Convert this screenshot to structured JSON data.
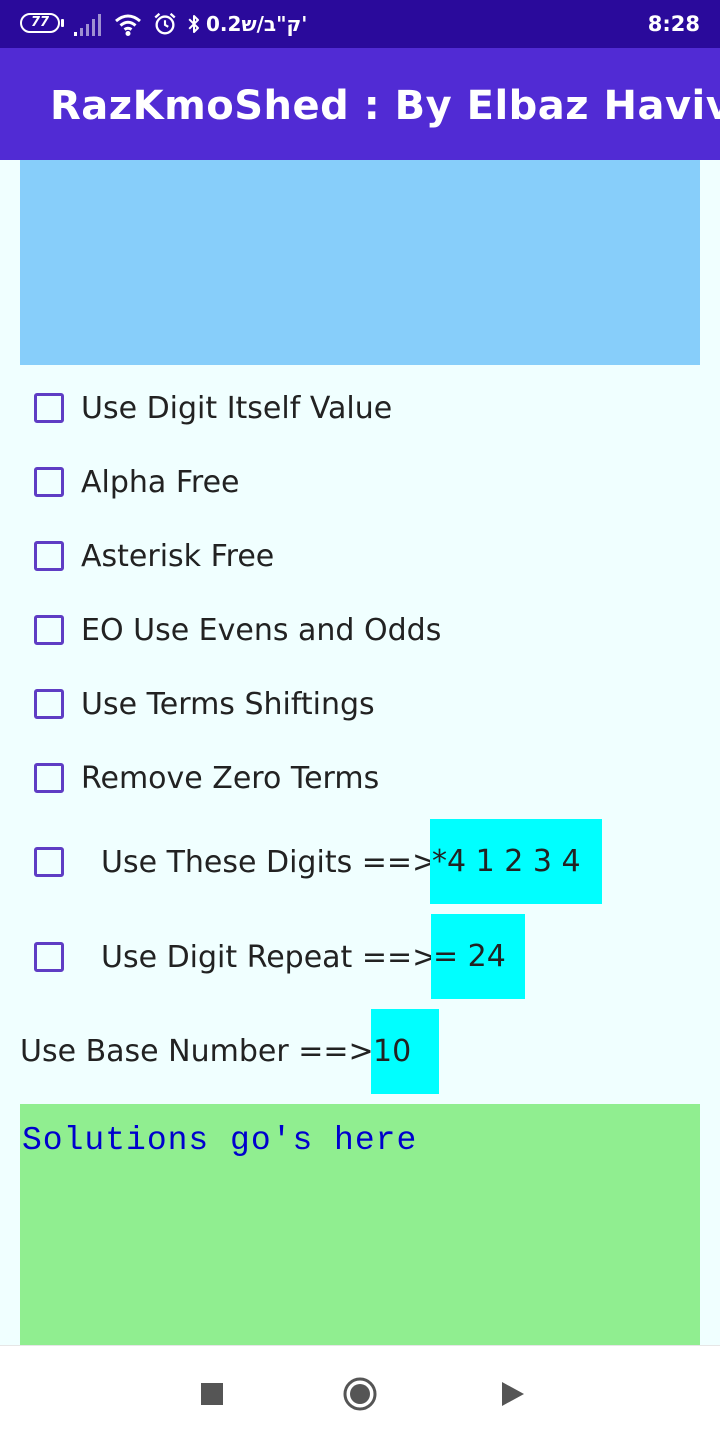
{
  "status_bar": {
    "battery": "77",
    "carrier_text": "0.2ק\"ב/ש'",
    "time": "8:28",
    "icons": [
      "signal-icon",
      "wifi-icon",
      "alarm-icon",
      "bluetooth-icon"
    ]
  },
  "app_bar": {
    "title": "RazKmoShed : By Elbaz Haviv"
  },
  "options": {
    "use_digit_itself_value": "Use Digit Itself Value",
    "alpha_free": "Alpha Free",
    "asterisk_free": "Asterisk Free",
    "eo_use_evens_and_odds": "EO Use Evens and Odds",
    "use_terms_shiftings": "Use Terms Shiftings",
    "remove_zero_terms": "Remove Zero Terms"
  },
  "digits": {
    "label": "Use These Digits ==>",
    "value": "*4 1 2 3 4"
  },
  "repeat": {
    "label": "Use Digit Repeat ==>",
    "value": "= 24"
  },
  "base": {
    "label": "Use Base Number ==>",
    "value": "10"
  },
  "solutions": {
    "text": "Solutions go's here"
  },
  "colors": {
    "status_bar": "#2a0a9b",
    "app_bar": "#512bd4",
    "top_panel": "#87cefa",
    "page_background": "#f0ffff",
    "input_background": "#00ffff",
    "solutions_background": "#90ee90",
    "solutions_text": "#0000cd",
    "checkbox_border": "#5f3dc4"
  },
  "nav_bar": {
    "icons": [
      "square-recents-icon",
      "circle-home-icon",
      "triangle-back-icon"
    ]
  }
}
